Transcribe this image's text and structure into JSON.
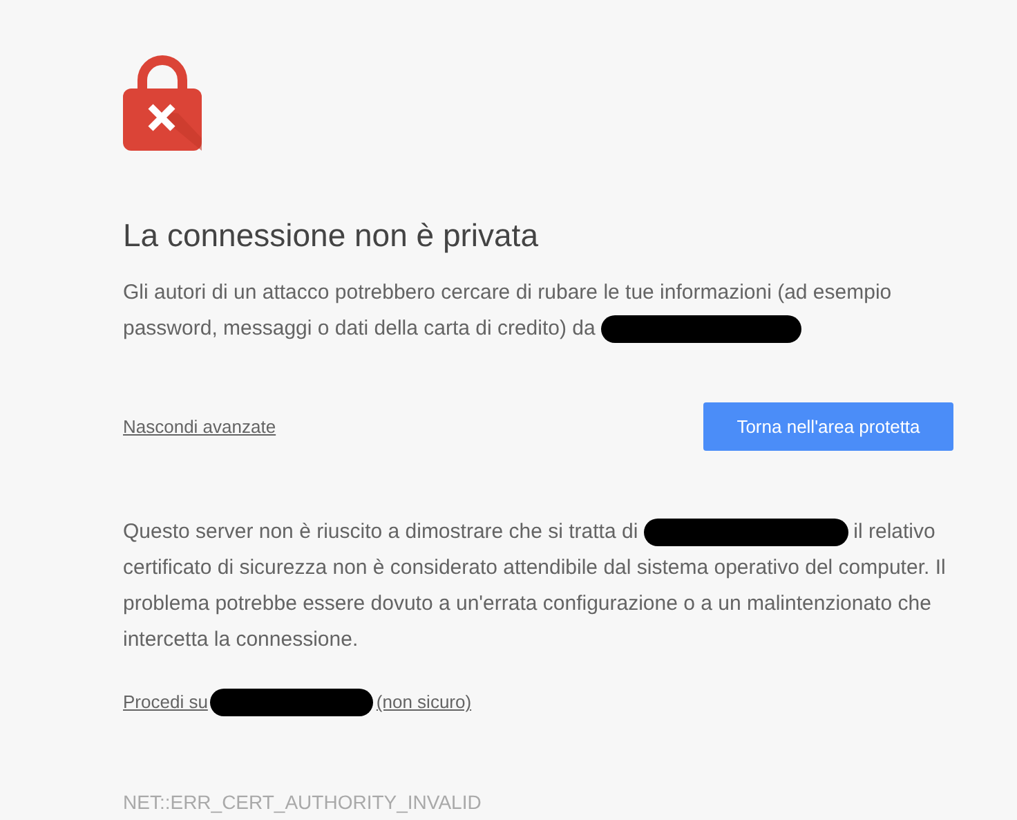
{
  "heading": "La connessione non è privata",
  "intro": [
    "Gli autori di un attacco potrebbero cercare di rubare le tue informazioni (ad esempio",
    "password, messaggi o dati della carta di credito) da"
  ],
  "advanced_link": "Nascondi avanzate",
  "primary_button": "Torna nell'area protetta",
  "details": {
    "before": "Questo server non è riuscito a dimostrare che si tratta di",
    "after": "il relativo",
    "rest": [
      "certificato di sicurezza non è considerato attendibile dal sistema operativo del computer. Il",
      "problema potrebbe essere dovuto a un'errata configurazione o a un malintenzionato che",
      "intercetta la connessione."
    ]
  },
  "proceed_link": {
    "before": "Procedi su",
    "after": "(non sicuro)"
  },
  "error_code": "NET::ERR_CERT_AUTHORITY_INVALID"
}
